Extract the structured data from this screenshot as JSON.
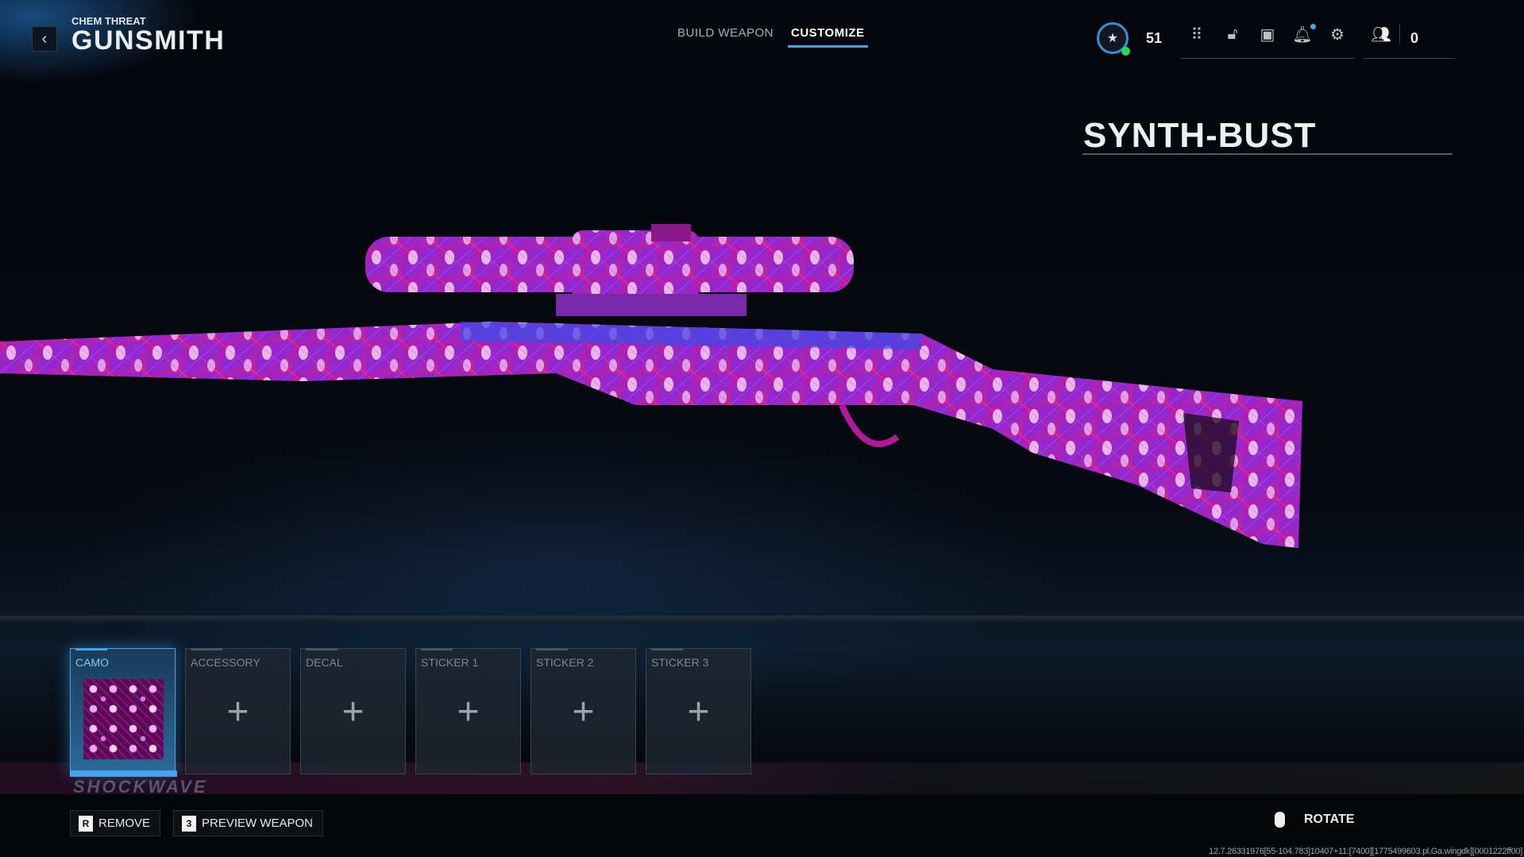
{
  "header": {
    "subtitle": "CHEM THREAT",
    "title": "GUNSMITH",
    "back_icon": "chevron-left-icon"
  },
  "tabs": [
    {
      "label": "BUILD WEAPON",
      "active": false
    },
    {
      "label": "CUSTOMIZE",
      "active": true
    }
  ],
  "topbar": {
    "rank_level": "51",
    "friends_count": "0",
    "icons": [
      "rank-icon",
      "grid-icon",
      "unlock-icon",
      "headset-icon",
      "bell-icon",
      "gear-icon",
      "friends-icon"
    ],
    "accent": "#4aa3e8"
  },
  "item": {
    "name": "SYNTH-BUST"
  },
  "slots": [
    {
      "label": "CAMO",
      "selected": true
    },
    {
      "label": "ACCESSORY",
      "selected": false
    },
    {
      "label": "DECAL",
      "selected": false
    },
    {
      "label": "STICKER 1",
      "selected": false
    },
    {
      "label": "STICKER 2",
      "selected": false
    },
    {
      "label": "STICKER 3",
      "selected": false
    }
  ],
  "background_text": "SHOCKWAVE",
  "actions": [
    {
      "key": "R",
      "label": "REMOVE"
    },
    {
      "key": "3",
      "label": "PREVIEW WEAPON"
    }
  ],
  "rotate_label": "ROTATE",
  "debug": "12.7.26331976[55-104.783]10407+11:[7400][1775499603.pl.Ga.wingdk][0001222ff00]"
}
